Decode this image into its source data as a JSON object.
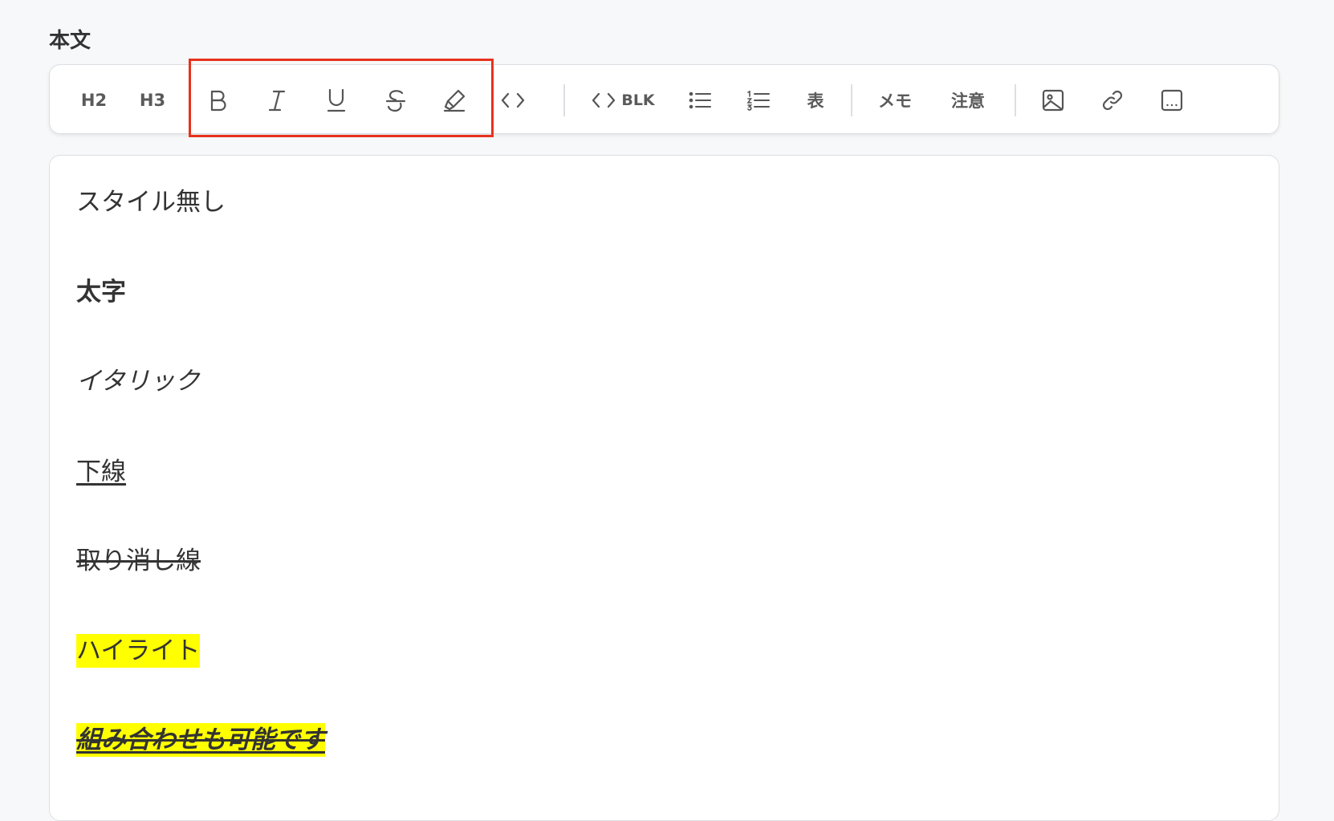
{
  "section": {
    "label": "本文"
  },
  "toolbar": {
    "h2_label": "H2",
    "h3_label": "H3",
    "code_block_label": "BLK",
    "table_label": "表",
    "memo_label": "メモ",
    "caution_label": "注意",
    "icons": {
      "bold": "bold-icon",
      "italic": "italic-icon",
      "underline": "underline-icon",
      "strikethrough": "strikethrough-icon",
      "highlight": "highlighter-icon",
      "inline_code": "code-icon",
      "bulleted_list": "bulleted-list-icon",
      "numbered_list": "numbered-list-icon",
      "image": "image-icon",
      "link": "link-icon",
      "embed": "embed-icon"
    },
    "annotation_color": "#e8321e"
  },
  "editor": {
    "lines": [
      {
        "text": "スタイル無し",
        "style": "plain"
      },
      {
        "text": "太字",
        "style": "bold"
      },
      {
        "text": "イタリック",
        "style": "italic"
      },
      {
        "text": "下線",
        "style": "underline"
      },
      {
        "text": "取り消し線",
        "style": "strikethrough"
      },
      {
        "text": "ハイライト",
        "style": "highlight"
      },
      {
        "text": "組み合わせも可能です",
        "style": "bold italic underline strikethrough highlight"
      }
    ],
    "highlight_color": "#ffff00"
  }
}
